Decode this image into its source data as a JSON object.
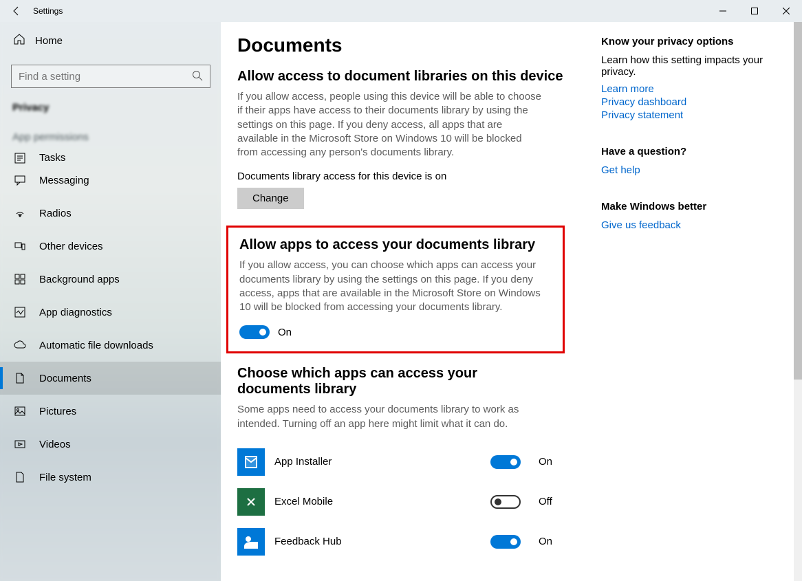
{
  "window": {
    "title": "Settings"
  },
  "sidebar": {
    "home": "Home",
    "search_placeholder": "Find a setting",
    "section": "Privacy",
    "group": "App permissions",
    "items": [
      {
        "label": "Tasks",
        "icon": "tasks"
      },
      {
        "label": "Messaging",
        "icon": "messaging"
      },
      {
        "label": "Radios",
        "icon": "radios"
      },
      {
        "label": "Other devices",
        "icon": "other-devices"
      },
      {
        "label": "Background apps",
        "icon": "background-apps"
      },
      {
        "label": "App diagnostics",
        "icon": "diagnostics"
      },
      {
        "label": "Automatic file downloads",
        "icon": "downloads"
      },
      {
        "label": "Documents",
        "icon": "documents",
        "selected": true
      },
      {
        "label": "Pictures",
        "icon": "pictures"
      },
      {
        "label": "Videos",
        "icon": "videos"
      },
      {
        "label": "File system",
        "icon": "file-system"
      }
    ]
  },
  "main": {
    "title": "Documents",
    "section1": {
      "heading": "Allow access to document libraries on this device",
      "description": "If you allow access, people using this device will be able to choose if their apps have access to their documents library by using the settings on this page. If you deny access, all apps that are available in the Microsoft Store on Windows 10 will be blocked from accessing any person's documents library.",
      "status": "Documents library access for this device is on",
      "change": "Change"
    },
    "section2": {
      "heading": "Allow apps to access your documents library",
      "description": "If you allow access, you can choose which apps can access your documents library by using the settings on this page. If you deny access, apps that are available in the Microsoft Store on Windows 10 will be blocked from accessing your documents library.",
      "toggle_state": "On",
      "toggle_on": true
    },
    "section3": {
      "heading": "Choose which apps can access your documents library",
      "description": "Some apps need to access your documents library to work as intended. Turning off an app here might limit what it can do.",
      "apps": [
        {
          "name": "App Installer",
          "state": "On",
          "on": true,
          "color": "blue"
        },
        {
          "name": "Excel Mobile",
          "state": "Off",
          "on": false,
          "color": "green"
        },
        {
          "name": "Feedback Hub",
          "state": "On",
          "on": true,
          "color": "fb"
        }
      ]
    }
  },
  "right": {
    "block1": {
      "heading": "Know your privacy options",
      "text": "Learn how this setting impacts your privacy.",
      "links": [
        "Learn more",
        "Privacy dashboard",
        "Privacy statement"
      ]
    },
    "block2": {
      "heading": "Have a question?",
      "links": [
        "Get help"
      ]
    },
    "block3": {
      "heading": "Make Windows better",
      "links": [
        "Give us feedback"
      ]
    }
  }
}
